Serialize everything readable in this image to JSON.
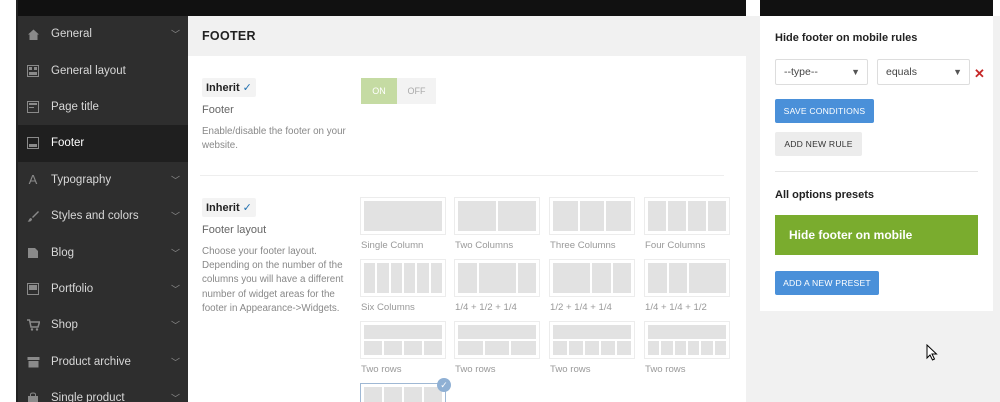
{
  "sidebar": {
    "items": [
      {
        "label": "General",
        "icon": "home-icon",
        "chevron": true
      },
      {
        "label": "General layout",
        "icon": "layout-icon",
        "chevron": false
      },
      {
        "label": "Page title",
        "icon": "page-title-icon",
        "chevron": false
      },
      {
        "label": "Footer",
        "icon": "footer-icon",
        "chevron": false,
        "active": true
      },
      {
        "label": "Typography",
        "icon": "typography-icon",
        "chevron": true
      },
      {
        "label": "Styles and colors",
        "icon": "brush-icon",
        "chevron": true
      },
      {
        "label": "Blog",
        "icon": "blog-icon",
        "chevron": true
      },
      {
        "label": "Portfolio",
        "icon": "portfolio-icon",
        "chevron": true
      },
      {
        "label": "Shop",
        "icon": "cart-icon",
        "chevron": true
      },
      {
        "label": "Product archive",
        "icon": "store-icon",
        "chevron": true
      },
      {
        "label": "Single product",
        "icon": "bag-icon",
        "chevron": true
      }
    ]
  },
  "main": {
    "title": "FOOTER",
    "footer_option": {
      "inherit_label": "Inherit",
      "inherit_check": "✓",
      "label": "Footer",
      "description": "Enable/disable the footer on your website.",
      "toggle_on": "ON",
      "toggle_off": "OFF",
      "value": "on"
    },
    "layout_option": {
      "inherit_label": "Inherit",
      "inherit_check": "✓",
      "label": "Footer layout",
      "description": "Choose your footer layout. Depending on the number of the columns you will have a different number of widget areas for the footer in Appearance->Widgets.",
      "layouts": [
        "Single Column",
        "Two Columns",
        "Three Columns",
        "Four Columns",
        "Six Columns",
        "1/4 + 1/2 + 1/4",
        "1/2 + 1/4 + 1/4",
        "1/4 + 1/4 + 1/2",
        "Two rows",
        "Two rows",
        "Two rows",
        "Two rows"
      ],
      "selected_check": "✓"
    }
  },
  "right_panel": {
    "rules_title": "Hide footer on mobile rules",
    "type_select": "--type--",
    "condition_select": "equals",
    "remove_symbol": "✕",
    "save_button": "SAVE CONDITIONS",
    "add_rule_button": "ADD NEW RULE",
    "presets_title": "All options presets",
    "preset_name": "Hide footer on mobile",
    "add_preset_button": "ADD A NEW PRESET"
  },
  "colors": {
    "sidebar_bg": "#2e2e2e",
    "accent_blue": "#4a90d9",
    "preset_green": "#7aac2e",
    "toggle_on": "#c5dba3",
    "remove_red": "#c62828"
  }
}
